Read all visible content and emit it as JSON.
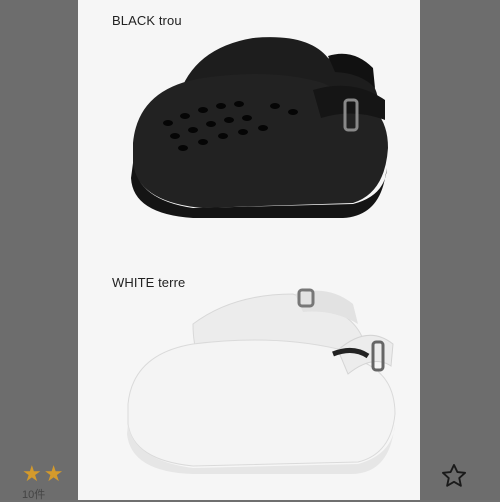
{
  "variants": [
    {
      "label": "BLACK trou",
      "color": "#1a1a1a"
    },
    {
      "label": "WHITE terre",
      "color": "#f2f2f2"
    }
  ],
  "rating": {
    "stars_filled": 2,
    "count_text": "10件"
  },
  "icons": {
    "wishlist": "star-outline-icon"
  },
  "colors": {
    "panel_bg": "#f6f6f6",
    "overlay": "#6f6f6f",
    "star": "#d49a2b"
  }
}
